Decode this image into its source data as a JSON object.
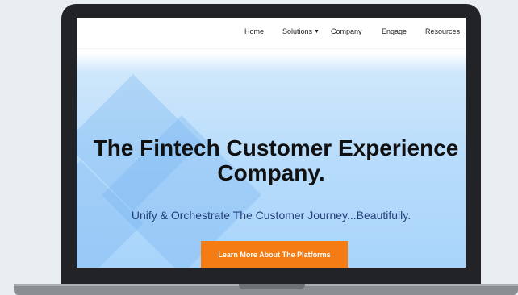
{
  "nav": {
    "items": [
      {
        "label": "Home"
      },
      {
        "label": "Solutions"
      },
      {
        "label": "Company"
      },
      {
        "label": "Engage"
      },
      {
        "label": "Resources"
      }
    ],
    "solutions_icon": "chevron-down-icon"
  },
  "hero": {
    "title_line1": "The Fintech Customer Experience",
    "title_line2": "Company.",
    "subtitle": "Unify & Orchestrate The Customer Journey...Beautifully.",
    "cta_label": "Learn More About The Platforms"
  },
  "colors": {
    "cta": "#f47c12",
    "subtitle": "#23407a",
    "hero_bg": "#b9ddfb"
  }
}
